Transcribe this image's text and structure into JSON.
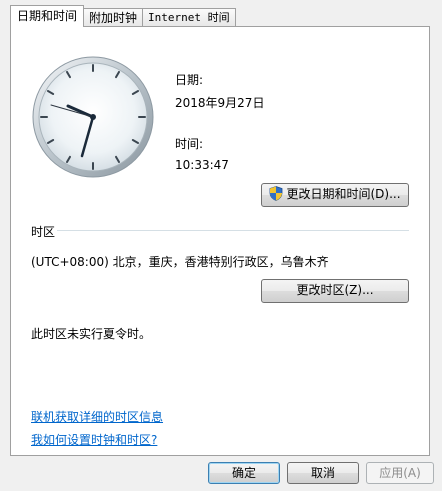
{
  "tabs": [
    {
      "label": "日期和时间"
    },
    {
      "label": "附加时钟"
    },
    {
      "label": "Internet 时间"
    }
  ],
  "date_label": "日期:",
  "date_value": "2018年9月27日",
  "time_label": "时间:",
  "time_value": "10:33:47",
  "change_datetime_button": "更改日期和时间(D)...",
  "timezone_section_label": "时区",
  "timezone_value": "(UTC+08:00) 北京，重庆，香港特别行政区，乌鲁木齐",
  "change_timezone_button": "更改时区(Z)...",
  "dst_note": "此时区未实行夏令时。",
  "links": [
    {
      "label": "联机获取详细的时区信息"
    },
    {
      "label": "我如何设置时钟和时区?"
    }
  ],
  "footer": {
    "ok_label": "确定",
    "cancel_label": "取消",
    "apply_label": "应用(A)"
  },
  "colors": {
    "link": "#0066cc",
    "clock_hand": "#1b2a3a"
  },
  "icons": {
    "uac_shield": "shield-icon",
    "clock": "analog-clock"
  }
}
